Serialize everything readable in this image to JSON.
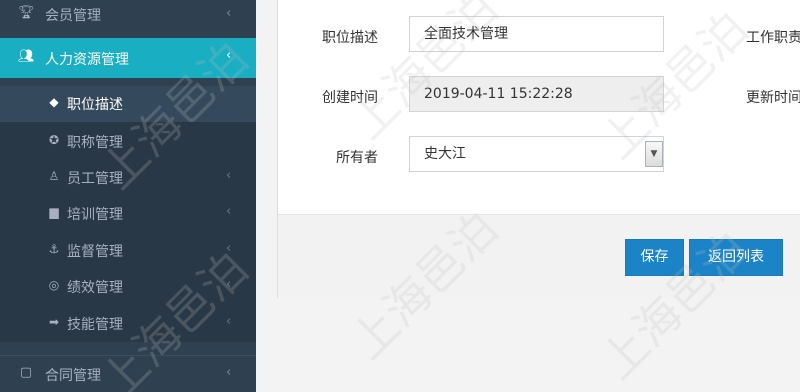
{
  "sidebar": {
    "top_item": {
      "label": "会员管理",
      "icon": "trophy-icon"
    },
    "active_section": {
      "label": "人力资源管理",
      "icon": "users-icon"
    },
    "sub_items": [
      {
        "label": "职位描述",
        "icon": "diamond-icon"
      },
      {
        "label": "职称管理",
        "icon": "certificate-icon"
      },
      {
        "label": "员工管理",
        "icon": "user-icon"
      },
      {
        "label": "培训管理",
        "icon": "briefcase-icon"
      },
      {
        "label": "监督管理",
        "icon": "anchor-icon"
      },
      {
        "label": "绩效管理",
        "icon": "globe-icon"
      },
      {
        "label": "技能管理",
        "icon": "tag-icon"
      }
    ],
    "bottom_item": {
      "label": "合同管理",
      "icon": "file-icon"
    }
  },
  "form": {
    "position_desc_label": "职位描述",
    "position_desc_value": "全面技术管理",
    "work_duty_label": "工作职责",
    "created_time_label": "创建时间",
    "created_time_value": "2019-04-11 15:22:28",
    "updated_time_label": "更新时间",
    "owner_label": "所有者",
    "owner_value": "史大江"
  },
  "actions": {
    "save_label": "保存",
    "back_label": "返回列表"
  },
  "watermark": {
    "text": "上海邑泊"
  },
  "colors": {
    "sidebar_bg": "#2f4050",
    "active_bg": "#19aec2",
    "button_primary": "#1c84c6"
  }
}
